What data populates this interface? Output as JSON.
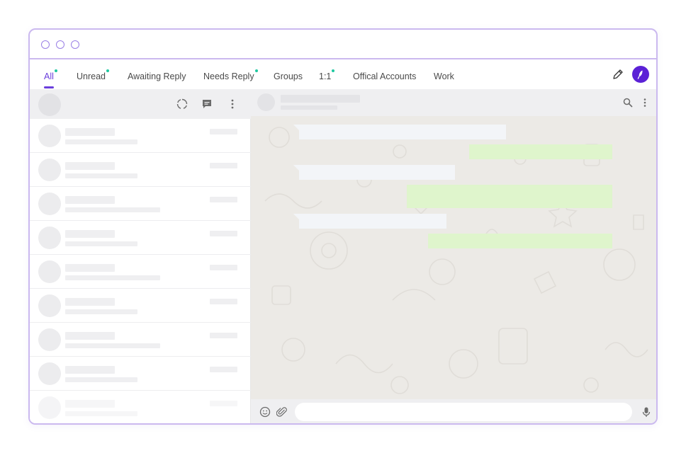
{
  "colors": {
    "accent": "#6a3fdc",
    "brand": "#5b21d6",
    "unread_dot": "#1fc8a0",
    "window_border": "#cbb9ef",
    "incoming_bubble": "#f3f5f8",
    "outgoing_bubble": "#dff5cc"
  },
  "tabs": [
    {
      "label": "All",
      "active": true,
      "unread": true
    },
    {
      "label": "Unread",
      "active": false,
      "unread": true
    },
    {
      "label": "Awaiting Reply",
      "active": false,
      "unread": false
    },
    {
      "label": "Needs Reply",
      "active": false,
      "unread": true
    },
    {
      "label": "Groups",
      "active": false,
      "unread": false
    },
    {
      "label": "1:1",
      "active": false,
      "unread": true
    },
    {
      "label": "Offical Accounts",
      "active": false,
      "unread": false
    },
    {
      "label": "Work",
      "active": false,
      "unread": false
    }
  ],
  "icons": {
    "window_controls": [
      "window-dot-icon",
      "window-dot-icon",
      "window-dot-icon"
    ],
    "toolbar": [
      "pencil-icon",
      "feather-logo-icon"
    ],
    "sidebar_header": [
      "status-ring-icon",
      "new-chat-icon",
      "more-vertical-icon"
    ],
    "chat_header": [
      "search-icon",
      "more-vertical-icon"
    ],
    "footer": [
      "emoji-icon",
      "attach-icon",
      "microphone-icon"
    ]
  },
  "chat_list": {
    "placeholder_rows": 9
  },
  "messages": [
    {
      "direction": "incoming"
    },
    {
      "direction": "outgoing"
    },
    {
      "direction": "incoming"
    },
    {
      "direction": "outgoing"
    },
    {
      "direction": "incoming"
    },
    {
      "direction": "outgoing"
    }
  ],
  "composer": {
    "value": "",
    "placeholder": ""
  }
}
